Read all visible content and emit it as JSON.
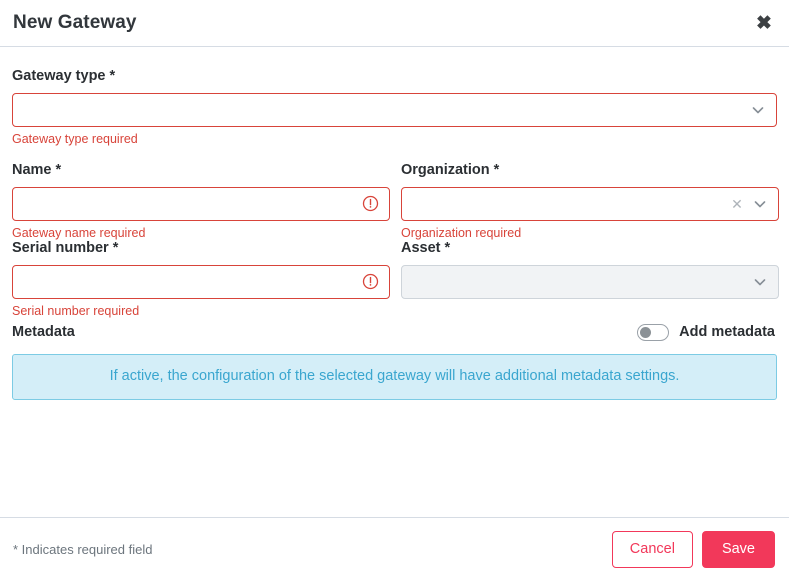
{
  "dialog": {
    "title": "New Gateway",
    "close_icon": "close-icon"
  },
  "fields": {
    "gateway_type": {
      "label": "Gateway type *",
      "value": "",
      "error": "Gateway type required",
      "control": "select",
      "state": "error",
      "icon": "chevron-down-icon"
    },
    "name": {
      "label": "Name *",
      "value": "",
      "error": "Gateway name required",
      "control": "text",
      "state": "error",
      "icon": "error-circle-icon"
    },
    "organization": {
      "label": "Organization *",
      "value": "",
      "error": "Organization required",
      "control": "select",
      "state": "error",
      "clear_icon": "clear-x-icon",
      "icon": "chevron-down-icon"
    },
    "serial_number": {
      "label": "Serial number *",
      "value": "",
      "error": "Serial number required",
      "control": "text",
      "state": "error",
      "icon": "error-circle-icon"
    },
    "asset": {
      "label": "Asset *",
      "value": "",
      "error": "",
      "control": "select",
      "state": "disabled",
      "icon": "chevron-down-icon"
    }
  },
  "metadata": {
    "section_label": "Metadata",
    "toggle_label": "Add metadata",
    "toggle_state": "off",
    "info_text": "If active, the configuration of the selected gateway will have additional metadata settings."
  },
  "footer": {
    "required_note": "* Indicates required field",
    "cancel_label": "Cancel",
    "save_label": "Save"
  },
  "colors": {
    "error": "#d8443a",
    "accent": "#f2385a",
    "info_bg": "#d4eef8",
    "info_border": "#7ccbe4",
    "info_text": "#3aa6cf",
    "disabled_bg": "#f1f3f5"
  }
}
